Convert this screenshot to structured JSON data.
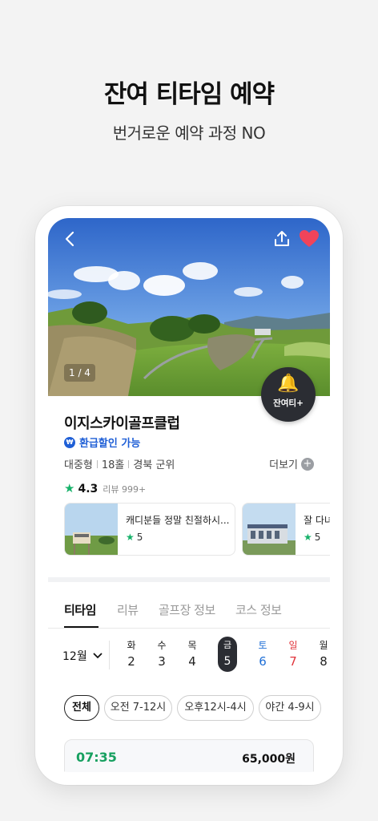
{
  "promo": {
    "headline": "잔여 티타임 예약",
    "subhead": "번거로운 예약 과정 NO"
  },
  "hero": {
    "counter": "1 / 4",
    "alert_label": "잔여티+",
    "icons": [
      "back-arrow-icon",
      "share-icon",
      "heart-icon",
      "bell-icon"
    ],
    "heart_color": "#f0445a"
  },
  "club": {
    "name": "이지스카이골프클럽",
    "refund_label": "환급할인 가능",
    "meta": [
      "대중형",
      "18홀",
      "경북 군위"
    ],
    "more_label": "더보기",
    "rating": "4.3",
    "review_count": "리뷰 999+"
  },
  "reviews": [
    {
      "text": "캐디분들 정말 친절하시...",
      "score": "5"
    },
    {
      "text": "잘 다녀",
      "score": "5"
    }
  ],
  "tabs": [
    "티타임",
    "리뷰",
    "골프장 정보",
    "코스 정보"
  ],
  "calendar": {
    "month": "12월",
    "days": [
      {
        "dow": "화",
        "num": "2"
      },
      {
        "dow": "수",
        "num": "3"
      },
      {
        "dow": "목",
        "num": "4"
      },
      {
        "dow": "금",
        "num": "5"
      },
      {
        "dow": "토",
        "num": "6"
      },
      {
        "dow": "일",
        "num": "7"
      },
      {
        "dow": "월",
        "num": "8"
      }
    ]
  },
  "filters": [
    "전체",
    "오전 7-12시",
    "오후12시-4시",
    "야간 4-9시"
  ],
  "teetime": {
    "time": "07:35",
    "price": "65,000원"
  },
  "colors": {
    "accent_green": "#17b26a",
    "link_blue": "#1f5fd6",
    "dark": "#2b2d33",
    "sunday_red": "#e0343b",
    "saturday_blue": "#1f6fd6"
  }
}
